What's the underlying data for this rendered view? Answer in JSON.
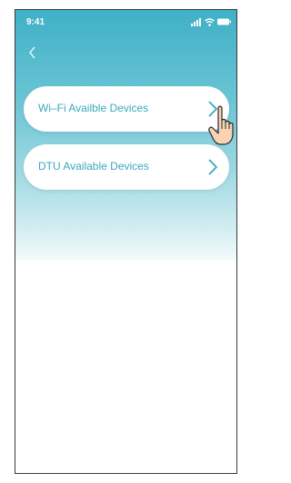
{
  "status_bar": {
    "time": "9:41",
    "signal_icon": "signal-bars-icon",
    "wifi_icon": "wifi-icon",
    "battery_icon": "battery-icon"
  },
  "nav": {
    "back_icon": "chevron-left-icon"
  },
  "device_options": [
    {
      "label": "Wi–Fi Availble Devices",
      "icon": "chevron-right-icon"
    },
    {
      "label": "DTU Available Devices",
      "icon": "chevron-right-icon"
    }
  ],
  "overlay": {
    "pointer_icon": "hand-pointer-icon"
  },
  "colors": {
    "accent": "#3aa8bd",
    "header_top": "#3fb0c6",
    "header_bottom": "#f4fbfc",
    "button_bg": "#ffffff"
  }
}
